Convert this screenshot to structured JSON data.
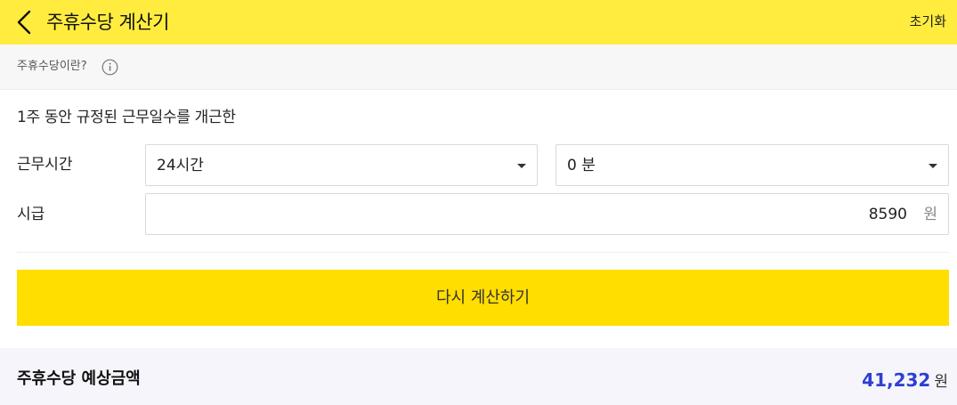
{
  "header": {
    "title": "주휴수당 계산기",
    "reset_label": "초기화",
    "back_icon": "chevron-left-icon",
    "background": "#ffec3f"
  },
  "info": {
    "text": "주휴수당이란?",
    "icon": "info-icon"
  },
  "form": {
    "description": "1주 동안 규정된 근무일수를 개근한",
    "work_time": {
      "label": "근무시간",
      "hours_value": "24시간",
      "minutes_value": "0 분"
    },
    "wage": {
      "label": "시급",
      "value": "8590",
      "unit": "원"
    },
    "calculate_button": "다시 계산하기",
    "button_color": "#ffde00"
  },
  "result": {
    "label": "주휴수당 예상금액",
    "value": "41,232",
    "unit": "원",
    "value_color": "#2e3fd1"
  }
}
